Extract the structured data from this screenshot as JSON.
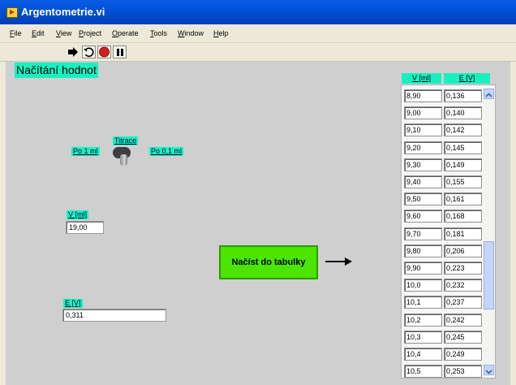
{
  "window": {
    "title": "Argentometrie.vi"
  },
  "menu": [
    {
      "pre": "",
      "u": "F",
      "post": "ile"
    },
    {
      "pre": "",
      "u": "E",
      "post": "dit"
    },
    {
      "pre": "",
      "u": "V",
      "post": "iew"
    },
    {
      "pre": "",
      "u": "P",
      "post": "roject"
    },
    {
      "pre": "",
      "u": "O",
      "post": "perate"
    },
    {
      "pre": "",
      "u": "T",
      "post": "ools"
    },
    {
      "pre": "",
      "u": "W",
      "post": "indow"
    },
    {
      "pre": "",
      "u": "H",
      "post": "elp"
    }
  ],
  "toolbar": {
    "buttons": [
      "run-arrow-icon",
      "run-continuous-icon",
      "abort-icon",
      "pause-icon"
    ]
  },
  "panel": {
    "heading": "Načítání hodnot",
    "switch": {
      "label": "Titrace",
      "left_label": "Po 1 ml",
      "right_label": "Po 0,1 ml"
    },
    "v": {
      "label": "V [ml]",
      "value": "19,00"
    },
    "e": {
      "label": "E [V]",
      "value": "0,311"
    },
    "load_button": "Načíst do tabulky"
  },
  "table": {
    "headers": [
      "V [ml]",
      "E [V]"
    ],
    "rows": [
      [
        "8,90",
        "0,136"
      ],
      [
        "9,00",
        "0,140"
      ],
      [
        "9,10",
        "0,142"
      ],
      [
        "9,20",
        "0,145"
      ],
      [
        "9,30",
        "0,149"
      ],
      [
        "9,40",
        "0,155"
      ],
      [
        "9,50",
        "0,161"
      ],
      [
        "9,60",
        "0,168"
      ],
      [
        "9,70",
        "0,181"
      ],
      [
        "9,80",
        "0,206"
      ],
      [
        "9,90",
        "0,223"
      ],
      [
        "10,0",
        "0,232"
      ],
      [
        "10,1",
        "0,237"
      ],
      [
        "10,2",
        "0,242"
      ],
      [
        "10,3",
        "0,245"
      ],
      [
        "10,4",
        "0,249"
      ],
      [
        "10,5",
        "0,253"
      ]
    ]
  },
  "colors": {
    "label_bg": "#19f0c0",
    "button_green": "#4be500",
    "panel_bg": "#cfcfcf"
  }
}
